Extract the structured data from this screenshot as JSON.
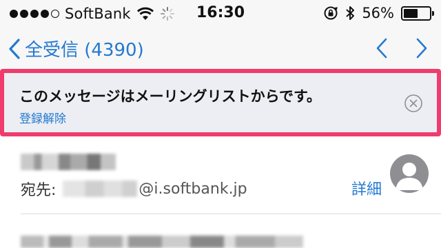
{
  "status_bar": {
    "carrier": "SoftBank",
    "time": "16:30",
    "battery_percent": "56%",
    "battery_level": 0.56,
    "signal_bars_filled": 4,
    "signal_bars_total": 5
  },
  "nav": {
    "back_label": "全受信 (4390)",
    "accent_color": "#2479d0"
  },
  "mailing_list_banner": {
    "message": "このメッセージはメーリングリストからです。",
    "unsubscribe_label": "登録解除",
    "highlight_color": "#f03b6e"
  },
  "header": {
    "to_label": "宛先:",
    "to_domain": "@i.softbank.jp",
    "details_label": "詳細"
  }
}
